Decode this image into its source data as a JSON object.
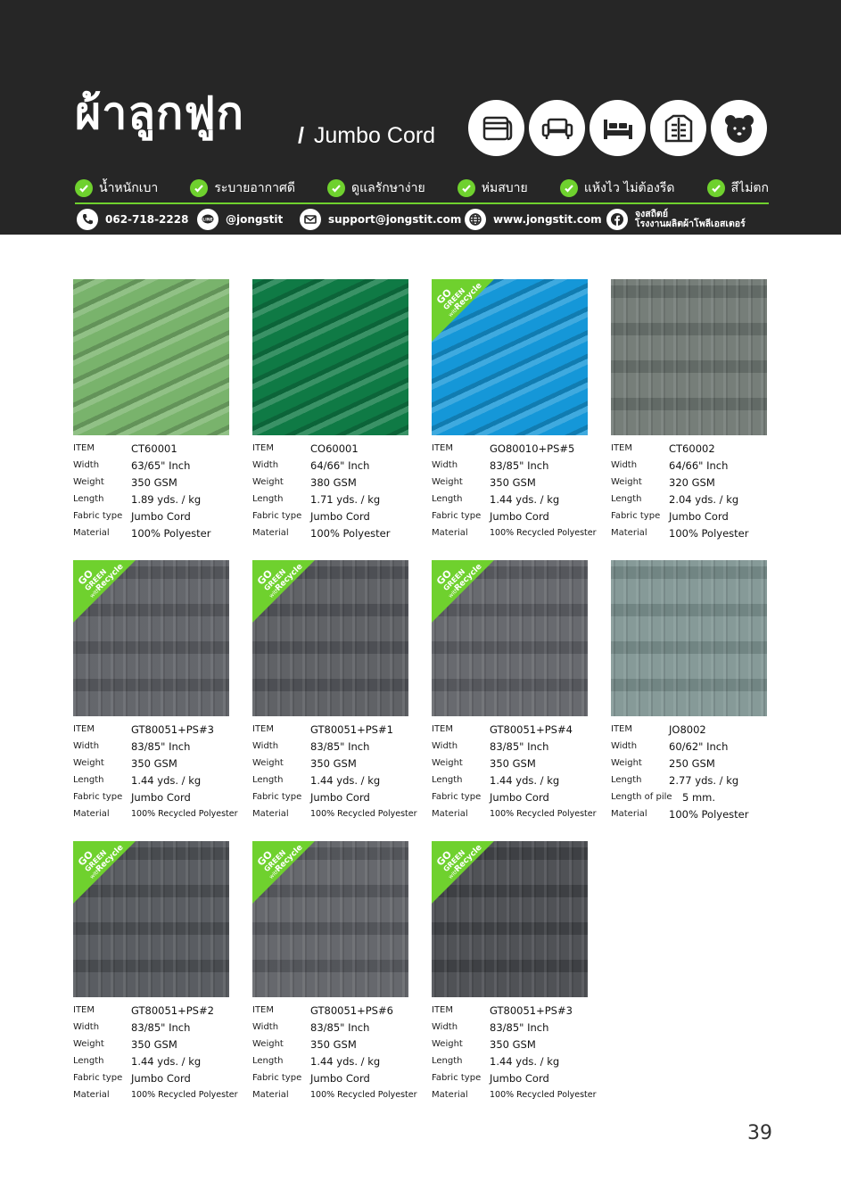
{
  "header": {
    "title_th": "ผ้าลูกฟูก",
    "title_en": "Jumbo Cord",
    "title_sep": "/",
    "category_icons": [
      "blanket-icon",
      "sofa-icon",
      "bed-icon",
      "jacket-icon",
      "bear-face-icon"
    ],
    "features": [
      {
        "label": "น้ำหนักเบา"
      },
      {
        "label": "ระบายอากาศดี"
      },
      {
        "label": "ดูแลรักษาง่าย"
      },
      {
        "label": "ห่มสบาย"
      },
      {
        "label": "แห้งไว ไม่ต้องรีด"
      },
      {
        "label": "สีไม่ตก"
      }
    ],
    "contacts": {
      "phone": "062-718-2228",
      "line": "@jongstit",
      "email": "support@jongstit.com",
      "website": "www.jongstit.com",
      "facebook_line1": "จงสถิตย์",
      "facebook_line2": "โรงงานผลิตผ้าโพลีเอสเตอร์"
    },
    "accent_color": "#6fd12e",
    "bg_color": "#262626"
  },
  "badge": {
    "line1": "GO",
    "line2": "GREEN",
    "line3": "with",
    "line4": "Recycle",
    "color": "#6fd12e"
  },
  "products": [
    {
      "swatch_color": "#79b36c",
      "badge": false,
      "specs": [
        {
          "label": "ITEM",
          "value": "CT60001"
        },
        {
          "label": "Width",
          "value": "63/65\" Inch"
        },
        {
          "label": "Weight",
          "value": "350 GSM"
        },
        {
          "label": "Length",
          "value": "1.89 yds. / kg"
        },
        {
          "label": "Fabric type",
          "value": "Jumbo Cord"
        },
        {
          "label": "Material",
          "value": "100% Polyester"
        }
      ]
    },
    {
      "swatch_color": "#0f7a45",
      "badge": false,
      "specs": [
        {
          "label": "ITEM",
          "value": "CO60001"
        },
        {
          "label": "Width",
          "value": "64/66\" Inch"
        },
        {
          "label": "Weight",
          "value": "380 GSM"
        },
        {
          "label": "Length",
          "value": "1.71 yds. / kg"
        },
        {
          "label": "Fabric type",
          "value": "Jumbo Cord"
        },
        {
          "label": "Material",
          "value": "100% Polyester"
        }
      ]
    },
    {
      "swatch_color": "#1597d8",
      "badge": true,
      "specs": [
        {
          "label": "ITEM",
          "value": "GO80010+PS#5"
        },
        {
          "label": "Width",
          "value": "83/85\" Inch"
        },
        {
          "label": "Weight",
          "value": "350 GSM"
        },
        {
          "label": "Length",
          "value": "1.44 yds. / kg"
        },
        {
          "label": "Fabric type",
          "value": "Jumbo Cord"
        },
        {
          "label": "Material",
          "value": "100% Recycled Polyester"
        }
      ]
    },
    {
      "swatch_color": "#6d7671",
      "badge": false,
      "specs": [
        {
          "label": "ITEM",
          "value": "CT60002"
        },
        {
          "label": "Width",
          "value": "64/66\" Inch"
        },
        {
          "label": "Weight",
          "value": "320 GSM"
        },
        {
          "label": "Length",
          "value": "2.04 yds. / kg"
        },
        {
          "label": "Fabric type",
          "value": "Jumbo Cord"
        },
        {
          "label": "Material",
          "value": "100% Polyester"
        }
      ]
    },
    {
      "swatch_color": "#5b5e63",
      "badge": true,
      "specs": [
        {
          "label": "ITEM",
          "value": "GT80051+PS#3"
        },
        {
          "label": "Width",
          "value": "83/85\" Inch"
        },
        {
          "label": "Weight",
          "value": "350 GSM"
        },
        {
          "label": "Length",
          "value": "1.44 yds. / kg"
        },
        {
          "label": "Fabric type",
          "value": "Jumbo Cord"
        },
        {
          "label": "Material",
          "value": "100% Recycled Polyester"
        }
      ]
    },
    {
      "swatch_color": "#56585d",
      "badge": true,
      "specs": [
        {
          "label": "ITEM",
          "value": "GT80051+PS#1"
        },
        {
          "label": "Width",
          "value": "83/85\" Inch"
        },
        {
          "label": "Weight",
          "value": "350 GSM"
        },
        {
          "label": "Length",
          "value": "1.44 yds. / kg"
        },
        {
          "label": "Fabric type",
          "value": "Jumbo Cord"
        },
        {
          "label": "Material",
          "value": "100% Recycled Polyester"
        }
      ]
    },
    {
      "swatch_color": "#5f6166",
      "badge": true,
      "specs": [
        {
          "label": "ITEM",
          "value": "GT80051+PS#4"
        },
        {
          "label": "Width",
          "value": "83/85\" Inch"
        },
        {
          "label": "Weight",
          "value": "350 GSM"
        },
        {
          "label": "Length",
          "value": "1.44 yds. / kg"
        },
        {
          "label": "Fabric type",
          "value": "Jumbo Cord"
        },
        {
          "label": "Material",
          "value": "100% Recycled Polyester"
        }
      ]
    },
    {
      "swatch_color": "#7e9492",
      "badge": false,
      "specs": [
        {
          "label": "ITEM",
          "value": "JO8002"
        },
        {
          "label": "Width",
          "value": "60/62\" Inch"
        },
        {
          "label": "Weight",
          "value": "250 GSM"
        },
        {
          "label": "Length",
          "value": "2.77 yds. / kg"
        },
        {
          "label": "Length of pile",
          "value": "5 mm."
        },
        {
          "label": "Material",
          "value": "100% Polyester"
        }
      ]
    },
    {
      "swatch_color": "#505358",
      "badge": true,
      "specs": [
        {
          "label": "ITEM",
          "value": "GT80051+PS#2"
        },
        {
          "label": "Width",
          "value": "83/85\" Inch"
        },
        {
          "label": "Weight",
          "value": "350 GSM"
        },
        {
          "label": "Length",
          "value": "1.44 yds. / kg"
        },
        {
          "label": "Fabric type",
          "value": "Jumbo Cord"
        },
        {
          "label": "Material",
          "value": "100% Recycled Polyester"
        }
      ]
    },
    {
      "swatch_color": "#5c5f64",
      "badge": true,
      "specs": [
        {
          "label": "ITEM",
          "value": "GT80051+PS#6"
        },
        {
          "label": "Width",
          "value": "83/85\" Inch"
        },
        {
          "label": "Weight",
          "value": "350 GSM"
        },
        {
          "label": "Length",
          "value": "1.44 yds. / kg"
        },
        {
          "label": "Fabric type",
          "value": "Jumbo Cord"
        },
        {
          "label": "Material",
          "value": "100% Recycled Polyester"
        }
      ]
    },
    {
      "swatch_color": "#45474c",
      "badge": true,
      "specs": [
        {
          "label": "ITEM",
          "value": "GT80051+PS#3"
        },
        {
          "label": "Width",
          "value": "83/85\" Inch"
        },
        {
          "label": "Weight",
          "value": "350 GSM"
        },
        {
          "label": "Length",
          "value": "1.44 yds. / kg"
        },
        {
          "label": "Fabric type",
          "value": "Jumbo Cord"
        },
        {
          "label": "Material",
          "value": "100% Recycled Polyester"
        }
      ]
    }
  ],
  "page_number": "39"
}
